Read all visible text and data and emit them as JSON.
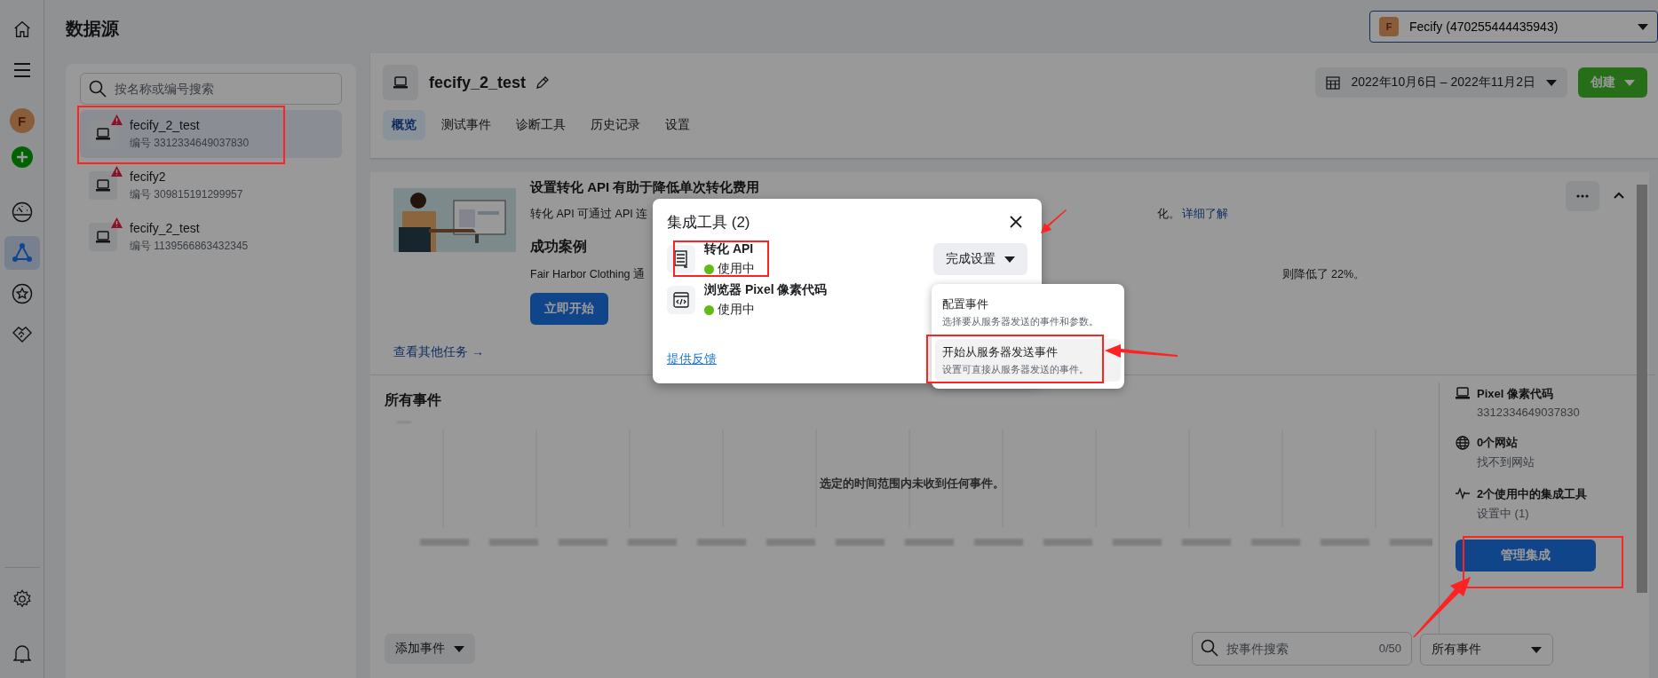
{
  "rail": {
    "top": [
      {
        "kind": "home",
        "selected": false
      },
      {
        "kind": "menu",
        "selected": false
      },
      {
        "kind": "avatar",
        "letter": "F",
        "selected": false
      },
      {
        "kind": "plus",
        "selected": false
      },
      {
        "kind": "gauge",
        "selected": false
      },
      {
        "kind": "nodes",
        "selected": true
      },
      {
        "kind": "star",
        "selected": false
      },
      {
        "kind": "handshake",
        "selected": false
      }
    ],
    "bottom": [
      {
        "kind": "gear",
        "selected": false
      },
      {
        "kind": "bell",
        "selected": false
      }
    ]
  },
  "page_title": "数据源",
  "account": {
    "letter": "F",
    "label": "Fecify (470255444435943)"
  },
  "sources": {
    "placeholder": "按名称或编号搜索",
    "items": [
      {
        "name": "fecify_2_test",
        "id": "编号 3312334649037830",
        "warning": true,
        "selected": true
      },
      {
        "name": "fecify2",
        "id": "编号 309815191299957",
        "warning": true,
        "selected": false
      },
      {
        "name": "fecify_2_test",
        "id": "编号 1139566863432345",
        "warning": true,
        "selected": false
      }
    ]
  },
  "main": {
    "name": "fecify_2_test",
    "tabs": [
      {
        "label": "概览",
        "selected": true
      },
      {
        "label": "测试事件",
        "selected": false
      },
      {
        "label": "诊断工具",
        "selected": false
      },
      {
        "label": "历史记录",
        "selected": false
      },
      {
        "label": "设置",
        "selected": false
      }
    ],
    "date_range": "2022年10月6日 – 2022年11月2日",
    "create": "创建"
  },
  "promo": {
    "title": "设置转化 API 有助于降低单次转化费用",
    "desc_start": "转化 API 可通过 API 连",
    "desc_end": "化。",
    "learn_more": "详细了解",
    "case_title": "成功案例",
    "case_start": "Fair Harbor Clothing 通",
    "case_end": "则降低了 22%。",
    "start": "立即开始",
    "more_tasks": "查看其他任务 →"
  },
  "events": {
    "title": "所有事件",
    "empty": "选定的时间范围内未收到任何事件。",
    "add": "添加事件",
    "search_placeholder": "按事件搜索",
    "count": "0/50",
    "filter": "所有事件"
  },
  "summary": {
    "items": [
      {
        "kind": "laptop",
        "title": "Pixel 像素代码",
        "subtitle": "3312334649037830"
      },
      {
        "kind": "globe",
        "title": "0个网站",
        "subtitle": "找不到网站"
      },
      {
        "kind": "pulse",
        "title": "2个使用中的集成工具",
        "subtitle": "设置中 (1)"
      }
    ],
    "manage": "管理集成"
  },
  "modal": {
    "title": "集成工具 (2)",
    "integrations": [
      {
        "kind": "server",
        "name": "转化 API",
        "status": "使用中"
      },
      {
        "kind": "code",
        "name": "浏览器 Pixel 像素代码",
        "status": "使用中"
      }
    ],
    "finish": "完成设置",
    "feedback": "提供反馈",
    "menu": [
      {
        "title": "配置事件",
        "desc": "选择要从服务器发送的事件和参数。",
        "selected": false
      },
      {
        "title": "开始从服务器发送事件",
        "desc": "设置可直接从服务器发送的事件。",
        "selected": true
      }
    ]
  }
}
